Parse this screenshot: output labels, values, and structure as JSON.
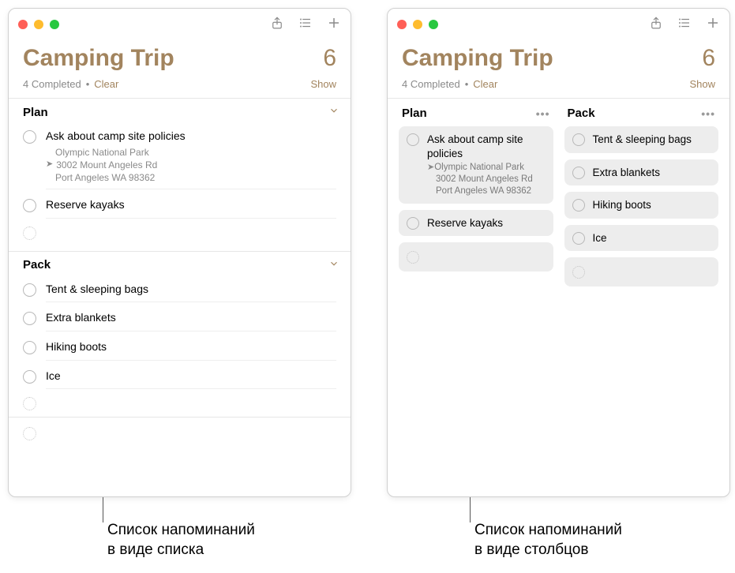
{
  "title": "Camping Trip",
  "count": "6",
  "completed_label": "4 Completed",
  "clear_label": "Clear",
  "show_label": "Show",
  "sections": {
    "plan": {
      "label": "Plan",
      "items": [
        {
          "title": "Ask about camp site policies",
          "location_name": "Olympic National Park",
          "location_addr1": "3002 Mount Angeles Rd",
          "location_addr2": "Port Angeles WA 98362"
        },
        {
          "title": "Reserve kayaks"
        }
      ]
    },
    "pack": {
      "label": "Pack",
      "items": [
        {
          "title": "Tent & sleeping bags"
        },
        {
          "title": "Extra blankets"
        },
        {
          "title": "Hiking boots"
        },
        {
          "title": "Ice"
        }
      ]
    }
  },
  "callouts": {
    "list_view": "Список напоминаний\nв виде списка",
    "column_view": "Список напоминаний\nв виде столбцов"
  }
}
